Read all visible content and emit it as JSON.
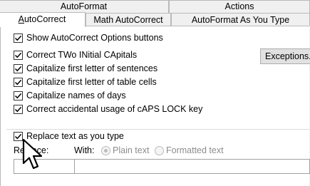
{
  "tabs_top": [
    {
      "label": "AutoFormat"
    },
    {
      "label": "Actions"
    }
  ],
  "tabs_bottom": [
    {
      "label": "AutoCorrect",
      "active": true
    },
    {
      "label": "Math AutoCorrect",
      "active": false
    },
    {
      "label": "AutoFormat As You Type",
      "active": false
    }
  ],
  "options": {
    "show_buttons": {
      "label": "Show AutoCorrect Options buttons",
      "checked": true
    },
    "two_initial_caps": {
      "label": "Correct TWo INitial CApitals",
      "checked": true
    },
    "first_letter_sentences": {
      "label": "Capitalize first letter of sentences",
      "checked": true
    },
    "first_letter_table_cells": {
      "label": "Capitalize first letter of table cells",
      "checked": true
    },
    "names_of_days": {
      "label": "Capitalize names of days",
      "checked": true
    },
    "caps_lock": {
      "label": "Correct accidental usage of cAPS LOCK key",
      "checked": true
    },
    "replace_text": {
      "label": "Replace text as you type",
      "checked": true
    }
  },
  "exceptions_button": "Exceptions...",
  "replace_label": "Replace:",
  "with_label": "With:",
  "plain_text_label": "Plain text",
  "formatted_text_label": "Formatted text",
  "plain_text_selected": true,
  "replace_input_value": "",
  "with_input_value": "",
  "colors": {
    "panel": "#ffffff",
    "dialog": "#f0f0f0",
    "disabled_text": "#8c8c8c"
  }
}
